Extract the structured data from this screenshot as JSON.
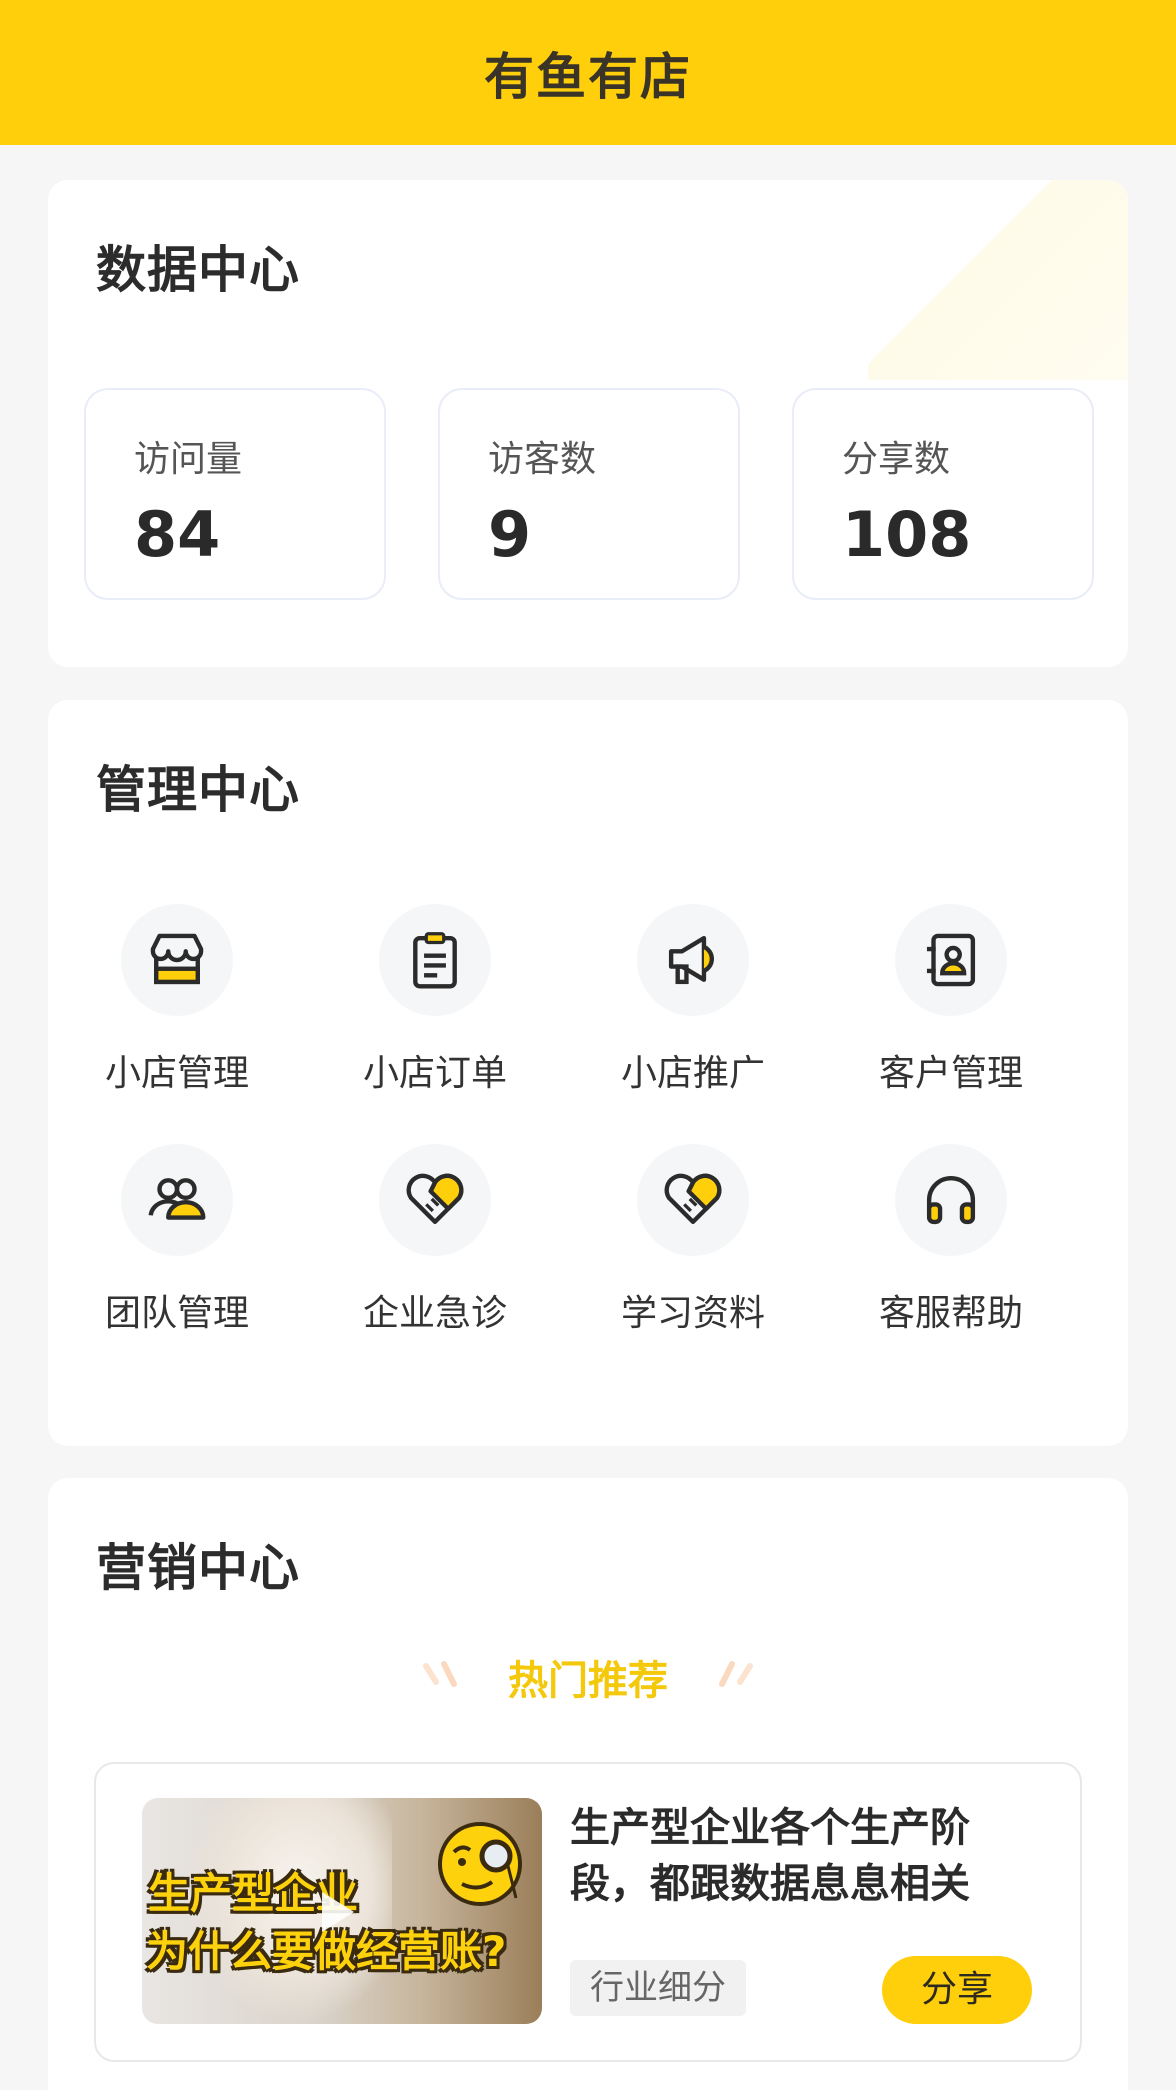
{
  "header": {
    "title": "有鱼有店"
  },
  "data_center": {
    "title": "数据中心",
    "stats": [
      {
        "label": "访问量",
        "value": "84"
      },
      {
        "label": "访客数",
        "value": "9"
      },
      {
        "label": "分享数",
        "value": "108"
      }
    ]
  },
  "management_center": {
    "title": "管理中心",
    "items": [
      {
        "label": "小店管理",
        "icon": "store-icon"
      },
      {
        "label": "小店订单",
        "icon": "clipboard-icon"
      },
      {
        "label": "小店推广",
        "icon": "megaphone-icon"
      },
      {
        "label": "客户管理",
        "icon": "contacts-book-icon"
      },
      {
        "label": "团队管理",
        "icon": "team-icon"
      },
      {
        "label": "企业急诊",
        "icon": "heart-bandage-icon"
      },
      {
        "label": "学习资料",
        "icon": "heart-bandage-icon"
      },
      {
        "label": "客服帮助",
        "icon": "headphones-icon"
      }
    ]
  },
  "marketing_center": {
    "title": "营销中心",
    "hot_title": "热门推荐",
    "recommendation": {
      "title": "生产型企业各个生产阶段，都跟数据息息相关",
      "thumb_line1": "生产型企业",
      "thumb_line2": "为什么要做经营账?",
      "tag": "行业细分",
      "share_label": "分享"
    }
  },
  "colors": {
    "accent": "#fecf0a",
    "hot_text": "#f4c80b",
    "background": "#f6f6f6"
  }
}
